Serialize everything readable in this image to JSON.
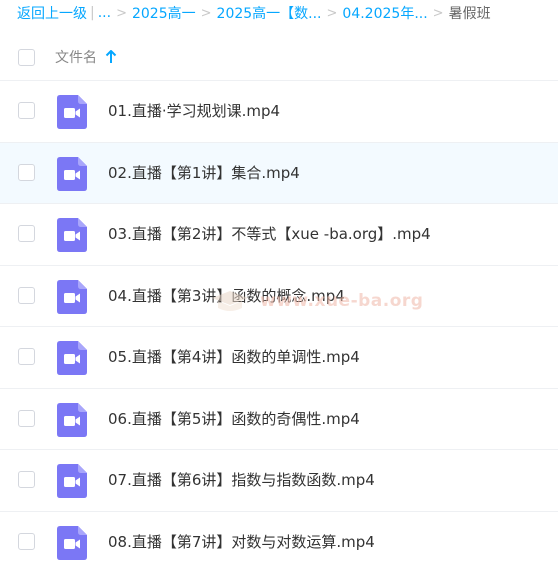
{
  "breadcrumb": {
    "back_label": "返回上一级",
    "ellipsis": "...",
    "items": [
      "2025高一",
      "2025高一【数...",
      "04.2025年..."
    ],
    "current": "暑假班"
  },
  "header": {
    "filename_label": "文件名"
  },
  "files": [
    {
      "name": "01.直播·学习规划课.mp4"
    },
    {
      "name": "02.直播【第1讲】集合.mp4"
    },
    {
      "name": "03.直播【第2讲】不等式【xue -ba.org】.mp4"
    },
    {
      "name": "04.直播【第3讲】函数的概念.mp4"
    },
    {
      "name": "05.直播【第4讲】函数的单调性.mp4"
    },
    {
      "name": "06.直播【第5讲】函数的奇偶性.mp4"
    },
    {
      "name": "07.直播【第6讲】指数与指数函数.mp4"
    },
    {
      "name": "08.直播【第7讲】对数与对数运算.mp4"
    }
  ],
  "watermark": {
    "text": "www.xue-ba.org"
  },
  "colors": {
    "link": "#06a7ff",
    "video_icon": "#7b77f5",
    "row_hover": "#f3faff"
  },
  "icons": {
    "file_type": "video-file-icon",
    "sort": "sort-ascending-arrow-icon"
  }
}
